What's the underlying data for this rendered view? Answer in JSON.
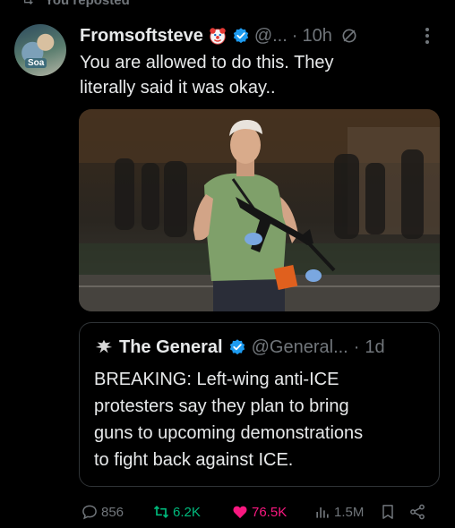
{
  "repost_banner": {
    "text": "You reposted"
  },
  "post": {
    "display_name": "Fromsoftsteve",
    "handle": "@...",
    "separator": "·",
    "time": "10h",
    "avatar_label": "Soa",
    "text_lines": [
      "You are allowed to do this. They",
      "literally said it was okay.."
    ],
    "icons": [
      "clown-emoji-icon",
      "verified-badge-icon",
      "edited-icon",
      "more-options-icon"
    ]
  },
  "quote": {
    "display_name": "The General",
    "handle": "@General...",
    "separator": "·",
    "time": "1d",
    "text_lines": [
      "BREAKING: Left-wing anti-ICE",
      "protesters say they plan to bring",
      "guns to upcoming demonstrations",
      "to fight back against ICE."
    ]
  },
  "actions": {
    "replies": "856",
    "reposts": "6.2K",
    "likes": "76.5K",
    "views": "1.5M"
  },
  "colors": {
    "background": "#000000",
    "text": "#e7e9ea",
    "muted": "#71767b",
    "verified": "#1d9bf0",
    "repost_active": "#00ba7c",
    "like_active": "#f91880",
    "border": "#2f3336"
  }
}
